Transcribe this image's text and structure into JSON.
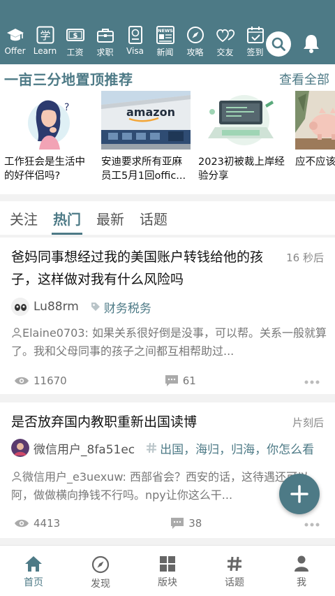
{
  "colors": {
    "accent": "#4d7a86",
    "background": "#f2f2f2"
  },
  "header": {
    "nav": [
      {
        "label": "Offer",
        "icon": "graduation-cap-icon"
      },
      {
        "label": "Learn",
        "icon": "learn-icon"
      },
      {
        "label": "工资",
        "icon": "cash-icon"
      },
      {
        "label": "求职",
        "icon": "briefcase-icon"
      },
      {
        "label": "Visa",
        "icon": "passport-icon"
      },
      {
        "label": "新闻",
        "icon": "newspaper-icon"
      },
      {
        "label": "攻略",
        "icon": "compass-icon"
      },
      {
        "label": "交友",
        "icon": "hearts-icon"
      },
      {
        "label": "签到",
        "icon": "calendar-check-icon"
      }
    ],
    "learn_glyph": "学",
    "news_glyph": "NEWS",
    "search_icon": "search-icon",
    "bell_icon": "bell-icon"
  },
  "featured": {
    "title": "一亩三分地置顶推荐",
    "more": "查看全部",
    "cards": [
      {
        "caption": "工作狂会是生活中的好伴侣吗?"
      },
      {
        "caption": "安迪要求所有亚麻员工5月1回offic...",
        "sign": "amazon"
      },
      {
        "caption": "2023初被裁上岸经验分享"
      },
      {
        "caption": "应不应该下，去存"
      }
    ]
  },
  "tabs": [
    {
      "label": "关注"
    },
    {
      "label": "热门",
      "active": true
    },
    {
      "label": "最新"
    },
    {
      "label": "话题"
    }
  ],
  "posts": [
    {
      "title": "爸妈同事想经过我的美国账户转钱给他的孩子，这样做对我有什么风险吗",
      "time": "16 秒后",
      "author": "Lu88rm",
      "tag": "财务税务",
      "reply": "Elaine0703: 如果关系很好倒是没事，可以帮。关系一般就算了。我和父母同事的孩子之间都互相帮助过...",
      "views": "11670",
      "comments": "61"
    },
    {
      "title": "是否放弃国内教职重新出国读博",
      "time": "片刻后",
      "author": "微信用户_8fa51ec",
      "tag": "出国，海归，归海，你怎么看",
      "reply": "微信用户_e3uexuw: 西部省会？西安的话，这待遇还可以阿，做做横向挣钱不行吗。npy让你这么干...",
      "views": "4413",
      "comments": "38"
    }
  ],
  "fab_icon": "plus-icon",
  "bottom_nav": [
    {
      "label": "首页",
      "icon": "home-icon",
      "active": true
    },
    {
      "label": "发现",
      "icon": "compass-icon"
    },
    {
      "label": "版块",
      "icon": "grid-icon"
    },
    {
      "label": "话题",
      "icon": "hashtag-icon"
    },
    {
      "label": "我",
      "icon": "person-icon"
    }
  ]
}
